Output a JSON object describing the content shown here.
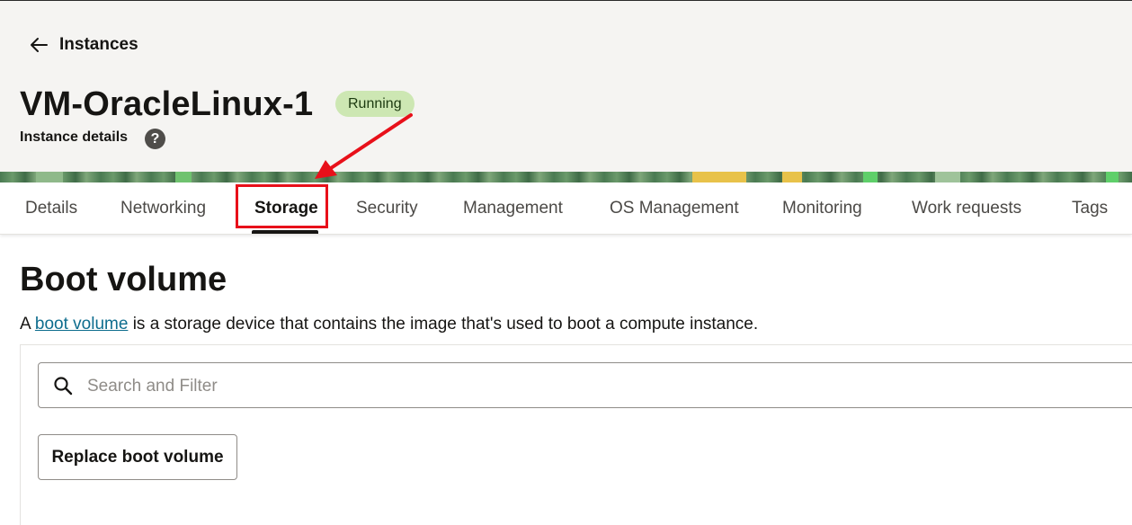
{
  "header": {
    "back_label": "Instances",
    "title": "VM-OracleLinux-1",
    "status": "Running",
    "subtitle": "Instance details",
    "help_glyph": "?"
  },
  "tabs": [
    {
      "label": "Details"
    },
    {
      "label": "Networking"
    },
    {
      "label": "Storage",
      "active": true
    },
    {
      "label": "Security"
    },
    {
      "label": "Management"
    },
    {
      "label": "OS Management"
    },
    {
      "label": "Monitoring"
    },
    {
      "label": "Work requests"
    },
    {
      "label": "Tags"
    }
  ],
  "section": {
    "title": "Boot volume",
    "desc_prefix": "A ",
    "desc_link": "boot volume",
    "desc_suffix": " is a storage device that contains the image that's used to boot a compute instance."
  },
  "search": {
    "placeholder": "Search and Filter",
    "icon": "search-icon"
  },
  "actions": {
    "replace_label": "Replace boot volume"
  },
  "colors": {
    "accent_red": "#e8101a",
    "status_green": "#cde7b3",
    "link": "#0e6d8e"
  }
}
